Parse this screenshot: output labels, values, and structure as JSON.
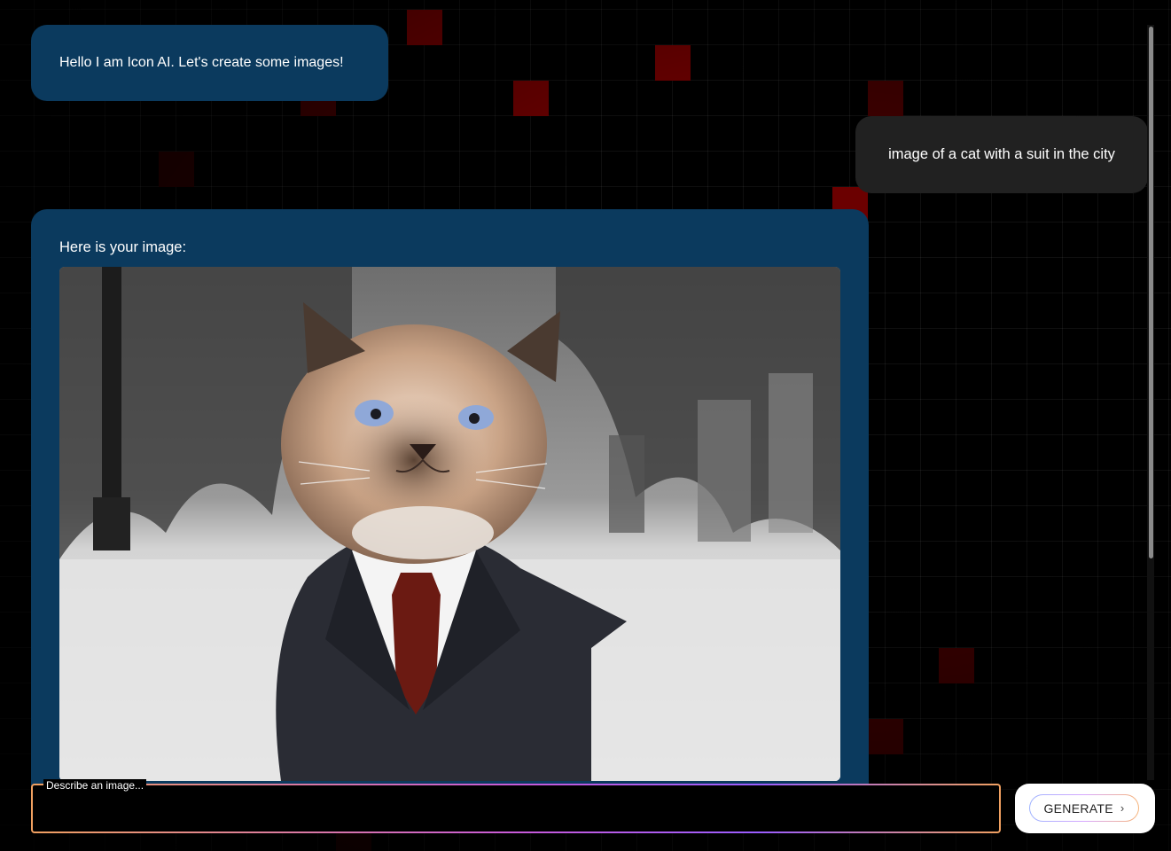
{
  "chat": {
    "greeting": "Hello I am Icon AI. Let's create some images!",
    "user_prompt": "image of a cat with a suit in the city",
    "response_caption": "Here is your image:"
  },
  "composer": {
    "label": "Describe an image...",
    "value": "",
    "generate_label": "GENERATE",
    "chevron": "›"
  },
  "colors": {
    "bot_bubble": "#0b3a5e",
    "user_bubble": "#212121",
    "accent_red": "#6b0000"
  }
}
